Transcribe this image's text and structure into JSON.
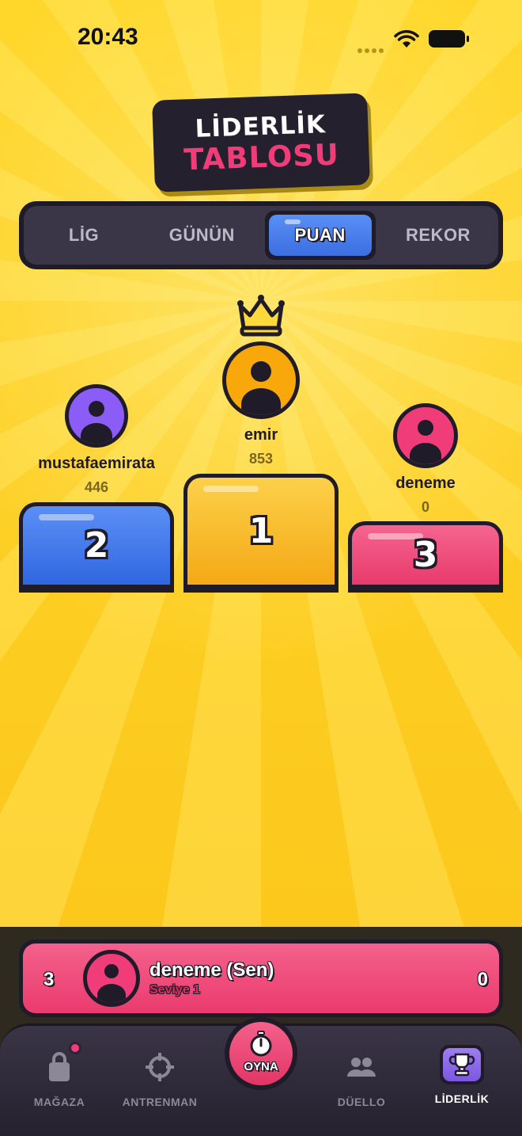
{
  "status_bar": {
    "time": "20:43"
  },
  "header": {
    "title_line1": "LİDERLİK",
    "title_line2": "TABLOSU"
  },
  "tabs": [
    {
      "label": "LİG",
      "active": false
    },
    {
      "label": "GÜNÜN",
      "active": false
    },
    {
      "label": "PUAN",
      "active": true
    },
    {
      "label": "REKOR",
      "active": false
    }
  ],
  "podium": {
    "first": {
      "rank": "1",
      "name": "emir",
      "score": "853",
      "avatar_color": "#f9a80b",
      "block_color": "#f9b51a"
    },
    "second": {
      "rank": "2",
      "name": "mustafaemirata",
      "score": "446",
      "avatar_color": "#8b5cf6",
      "block_color": "#3b75ea"
    },
    "third": {
      "rank": "3",
      "name": "deneme",
      "score": "0",
      "avatar_color": "#f03c78",
      "block_color": "#ec4577"
    }
  },
  "my_entry": {
    "rank": "3",
    "name": "deneme (Sen)",
    "level": "Seviye 1",
    "score": "0"
  },
  "nav": {
    "items": [
      {
        "label": "MAĞAZA",
        "icon": "shopping-bag-icon",
        "has_badge": true
      },
      {
        "label": "ANTRENMAN",
        "icon": "crosshair-icon"
      },
      {
        "label": "OYNA",
        "icon": "stopwatch-icon"
      },
      {
        "label": "DÜELLO",
        "icon": "users-icon"
      },
      {
        "label": "LİDERLİK",
        "icon": "trophy-icon",
        "active": true
      }
    ]
  },
  "colors": {
    "accent_pink": "#f03c78",
    "accent_blue": "#3b6ee0",
    "background_yellow": "#fdd21f",
    "dark": "#1f1b28"
  }
}
